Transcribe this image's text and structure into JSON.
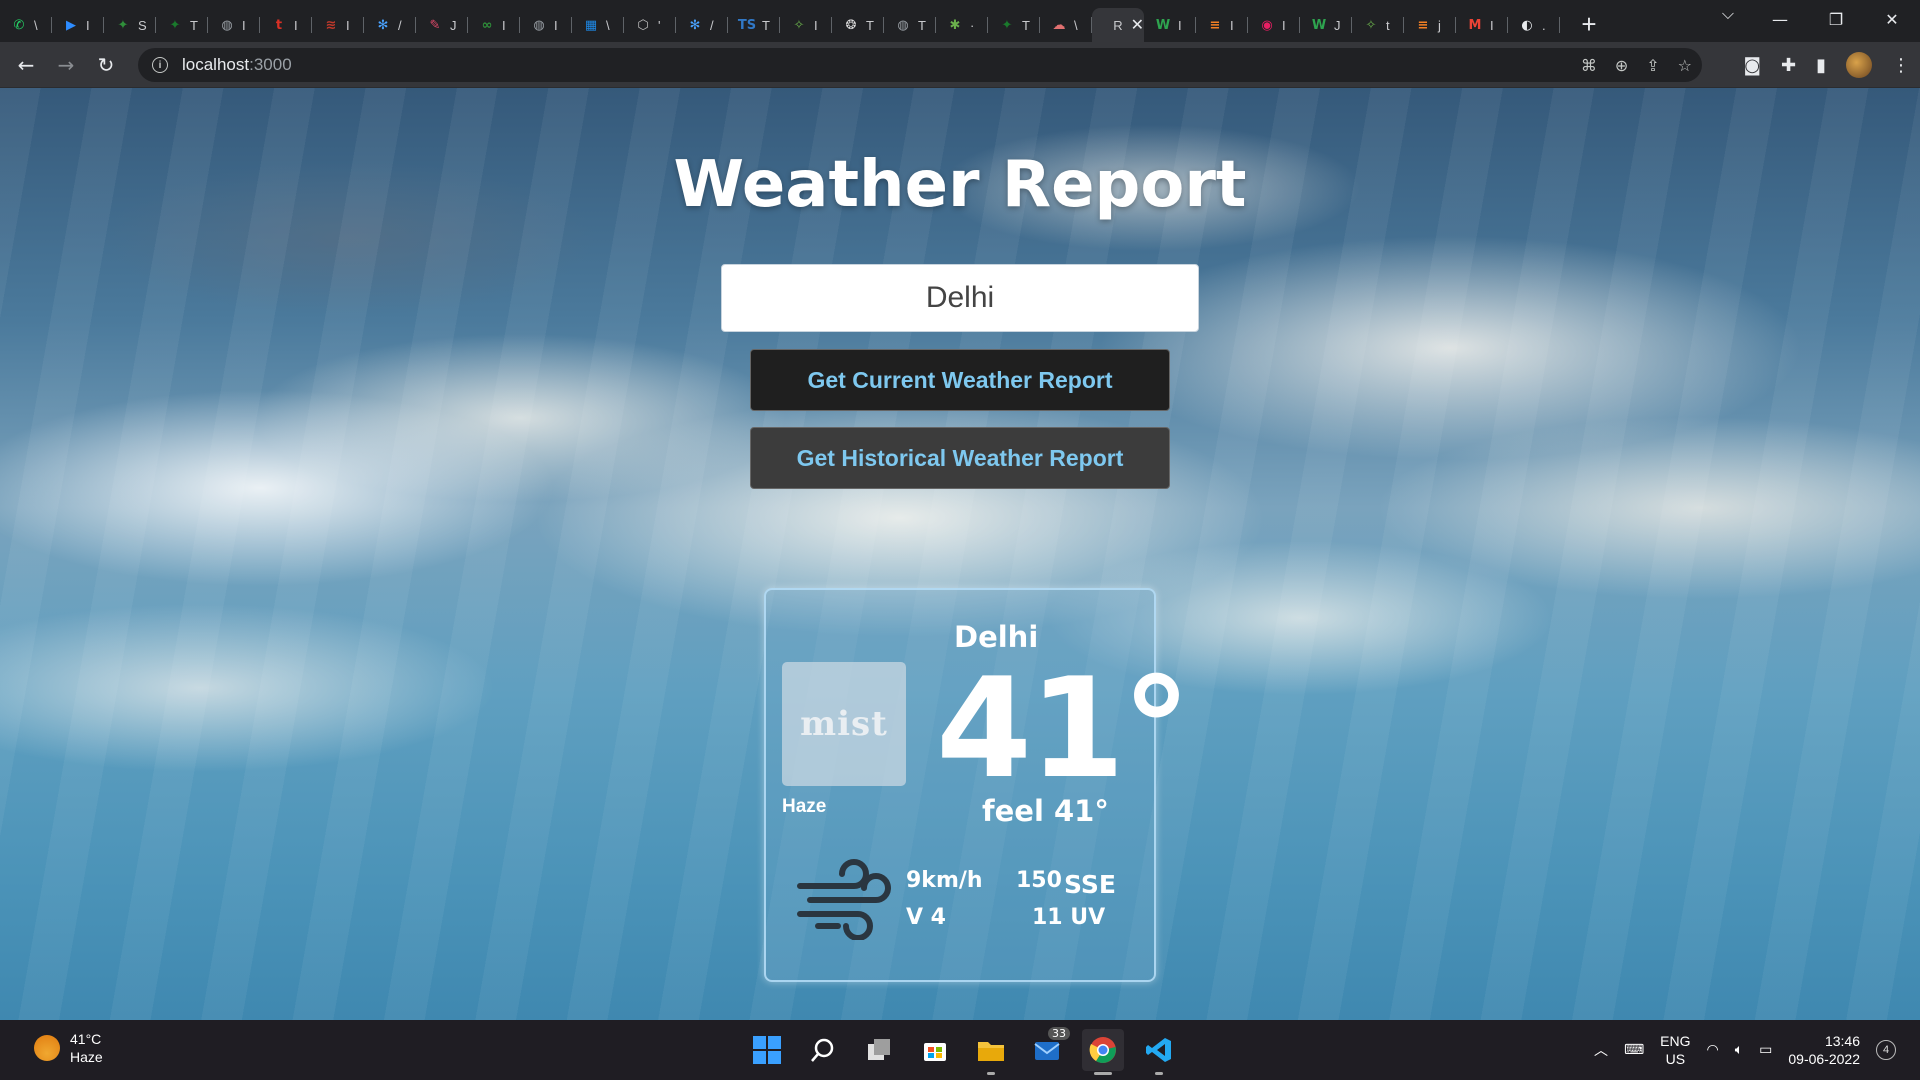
{
  "browser": {
    "tabs": [
      {
        "icon": "whatsapp-icon",
        "letter": "\\",
        "color": "#25d366",
        "glyph": "✆"
      },
      {
        "icon": "zoom-icon",
        "letter": "I",
        "color": "#2d8cff",
        "glyph": "▶"
      },
      {
        "icon": "leaf-icon",
        "letter": "S",
        "color": "#2f8f3a",
        "glyph": "✦"
      },
      {
        "icon": "run-icon",
        "letter": "T",
        "color": "#1a7a2c",
        "glyph": "✦"
      },
      {
        "icon": "globe-icon",
        "letter": "I",
        "color": "#9aa0a6",
        "glyph": "◍"
      },
      {
        "icon": "t-icon",
        "letter": "I",
        "color": "#d93025",
        "glyph": "t"
      },
      {
        "icon": "chart-icon",
        "letter": "I",
        "color": "#c0392b",
        "glyph": "≋"
      },
      {
        "icon": "snowflake-icon",
        "letter": "/",
        "color": "#4aa3ff",
        "glyph": "✻"
      },
      {
        "icon": "feather-icon",
        "letter": "J",
        "color": "#e04a6a",
        "glyph": "✎"
      },
      {
        "icon": "infinity-icon",
        "letter": "I",
        "color": "#2f8f3a",
        "glyph": "∞"
      },
      {
        "icon": "globe-icon",
        "letter": "I",
        "color": "#9aa0a6",
        "glyph": "◍"
      },
      {
        "icon": "app-icon",
        "letter": "\\",
        "color": "#1e88e5",
        "glyph": "▦"
      },
      {
        "icon": "hex-icon",
        "letter": "'",
        "color": "#bdbdbd",
        "glyph": "⬡"
      },
      {
        "icon": "snowflake-icon",
        "letter": "/",
        "color": "#4aa3ff",
        "glyph": "✻"
      },
      {
        "icon": "ts-icon",
        "letter": "T",
        "color": "#3178c6",
        "glyph": "TS"
      },
      {
        "icon": "spark-icon",
        "letter": "I",
        "color": "#6ab04c",
        "glyph": "✧"
      },
      {
        "icon": "openai-icon",
        "letter": "T",
        "color": "#dddddd",
        "glyph": "❂"
      },
      {
        "icon": "globe-icon",
        "letter": "T",
        "color": "#9aa0a6",
        "glyph": "◍"
      },
      {
        "icon": "puzzle-icon",
        "letter": "·",
        "color": "#6ab04c",
        "glyph": "✱"
      },
      {
        "icon": "run-icon",
        "letter": "T",
        "color": "#1a7a2c",
        "glyph": "✦"
      },
      {
        "icon": "cloud-icon",
        "letter": "\\",
        "color": "#e07070",
        "glyph": "☁"
      },
      {
        "icon": "react-icon",
        "letter": "R",
        "color": "#35363a",
        "glyph": "",
        "active": true
      },
      {
        "icon": "w-icon",
        "letter": "I",
        "color": "#2ea44f",
        "glyph": "W"
      },
      {
        "icon": "stack-icon",
        "letter": "I",
        "color": "#f48024",
        "glyph": "≡"
      },
      {
        "icon": "record-icon",
        "letter": "I",
        "color": "#e91e63",
        "glyph": "◉"
      },
      {
        "icon": "w-icon",
        "letter": "J",
        "color": "#2ea44f",
        "glyph": "W"
      },
      {
        "icon": "spark-icon",
        "letter": "t",
        "color": "#6ab04c",
        "glyph": "✧"
      },
      {
        "icon": "stack-icon",
        "letter": "j",
        "color": "#f48024",
        "glyph": "≡"
      },
      {
        "icon": "gmail-icon",
        "letter": "I",
        "color": "#ea4335",
        "glyph": "M"
      },
      {
        "icon": "github-icon",
        "letter": ".",
        "color": "#e8eaed",
        "glyph": "◐"
      }
    ],
    "active_tab_letter": "R",
    "url_host": "localhost",
    "url_port": ":3000",
    "window_controls": [
      "⌵",
      "—",
      "❐",
      "✕"
    ]
  },
  "page": {
    "title": "Weather Report",
    "city_input_value": "Delhi",
    "btn_current": "Get Current Weather Report",
    "btn_historical": "Get Historical Weather Report"
  },
  "card": {
    "city": "Delhi",
    "icon_text": "mist",
    "condition": "Haze",
    "temperature": "41°",
    "feels_like": "feel 41°",
    "wind_speed": "9km/h",
    "wind_degree": "150",
    "wind_direction": "SSE",
    "visibility": "V 4",
    "uv": "11 UV"
  },
  "taskbar": {
    "weather_temp": "41°C",
    "weather_cond": "Haze",
    "mail_badge": "33",
    "lang_top": "ENG",
    "lang_bottom": "US",
    "time": "13:46",
    "date": "09-06-2022",
    "notification_count": "4"
  }
}
